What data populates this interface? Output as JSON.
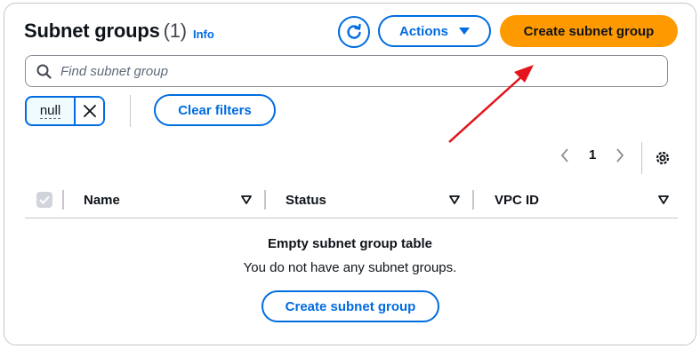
{
  "header": {
    "title": "Subnet groups",
    "count": "(1)",
    "info_label": "Info",
    "actions_label": "Actions",
    "create_label": "Create subnet group"
  },
  "search": {
    "placeholder": "Find subnet group"
  },
  "filters": {
    "token_label": "null",
    "clear_label": "Clear filters"
  },
  "pagination": {
    "current_page": "1"
  },
  "table": {
    "columns": [
      "Name",
      "Status",
      "VPC ID"
    ]
  },
  "empty_state": {
    "title": "Empty subnet group table",
    "description": "You do not have any subnet groups.",
    "button_label": "Create subnet group"
  },
  "colors": {
    "accent": "#006ce0",
    "primary_button": "#ff9900",
    "annotation_arrow": "#e3141b"
  },
  "icons": [
    "refresh-icon",
    "caret-down-icon",
    "search-icon",
    "close-icon",
    "chevron-left-icon",
    "chevron-right-icon",
    "gear-icon",
    "sort-icon",
    "checkbox-icon"
  ]
}
